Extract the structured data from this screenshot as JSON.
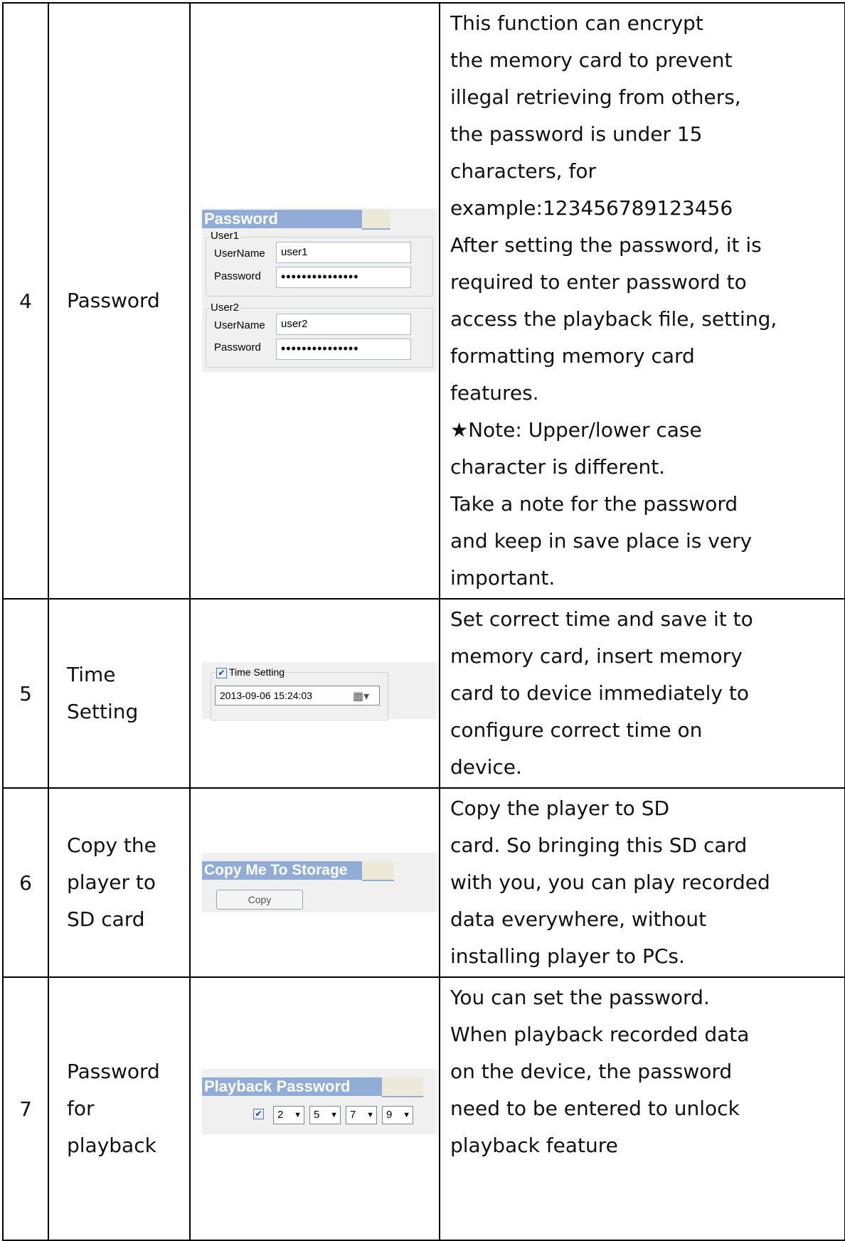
{
  "rows": [
    {
      "num": "4",
      "feature": [
        "Password"
      ],
      "description": [
        "This function can encrypt",
        "the memory card to prevent",
        "illegal retrieving from others,",
        "the password is under 15",
        "characters, for",
        "example:123456789123456",
        "After setting the password, it is",
        "required to enter password to",
        "access the playback file, setting,",
        "formatting memory card",
        "features.",
        "★Note: Upper/lower case",
        "character is different.",
        "Take a note for the password",
        "and keep in save place is very",
        "important."
      ],
      "screenshot": {
        "header": "Password",
        "user1": {
          "legend": "User1",
          "username_label": "UserName",
          "username_value": "user1",
          "password_label": "Password",
          "password_value": "•••••••••••••••"
        },
        "user2": {
          "legend": "User2",
          "username_label": "UserName",
          "username_value": "user2",
          "password_label": "Password",
          "password_value": "•••••••••••••••"
        }
      }
    },
    {
      "num": "5",
      "feature": [
        "Time",
        "Setting"
      ],
      "description": [
        "Set correct time and save it to",
        "memory card, insert memory",
        "card to device immediately to",
        "configure correct time on",
        "device."
      ],
      "screenshot": {
        "checkbox_label": "Time Setting",
        "checked": true,
        "datetime_value": "2013-09-06 15:24:03"
      }
    },
    {
      "num": "6",
      "feature": [
        "Copy the",
        "player to",
        "SD card"
      ],
      "description": [
        "Copy the player to SD",
        "card. So bringing this SD card",
        "with you, you can play recorded",
        "data everywhere, without",
        "installing player to PCs."
      ],
      "screenshot": {
        "header": "Copy Me To Storage",
        "button_label": "Copy"
      }
    },
    {
      "num": "7",
      "feature": [
        "Password",
        "for",
        "playback"
      ],
      "description": [
        "You can set the password.",
        "When playback recorded data",
        "on the device, the password",
        "need to be entered to unlock",
        "playback feature"
      ],
      "screenshot": {
        "header": "Playback Password",
        "checked": true,
        "digits": [
          "2",
          "5",
          "7",
          "9"
        ]
      }
    }
  ]
}
